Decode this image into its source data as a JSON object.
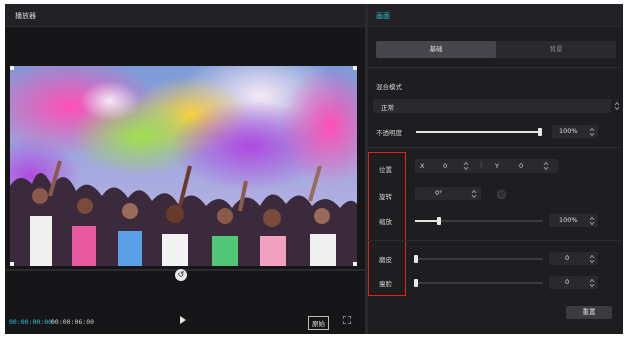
{
  "player": {
    "title": "播放器",
    "time_current": "00:00:00:00",
    "time_total": "00:00:06:00",
    "ratio_label": "原始"
  },
  "properties": {
    "tab": "画面",
    "segments": [
      "基础",
      "背景"
    ],
    "blend_mode_label": "混合模式",
    "blend_mode_value": "正常",
    "opacity_label": "不透明度",
    "opacity_value": "100%",
    "opacity_level": 1.0,
    "position_label": "位置",
    "x_label": "X",
    "x_value": "0",
    "y_label": "Y",
    "y_value": "0",
    "rotate_label": "旋转",
    "rotate_value": "0°",
    "scale_label": "缩放",
    "scale_value": "100%",
    "scale_level": 0.2,
    "blur_label": "磨皮",
    "blur_value": "0",
    "slim_label": "瘦脸",
    "slim_value": "0",
    "reset_label": "重置"
  },
  "colors": {
    "accent": "#29c4d2",
    "highlight": "#e2231a"
  },
  "icons": [
    "reset-circle-icon",
    "play-icon",
    "fullscreen-icon",
    "stepper-icon",
    "rotate-dial-icon"
  ]
}
